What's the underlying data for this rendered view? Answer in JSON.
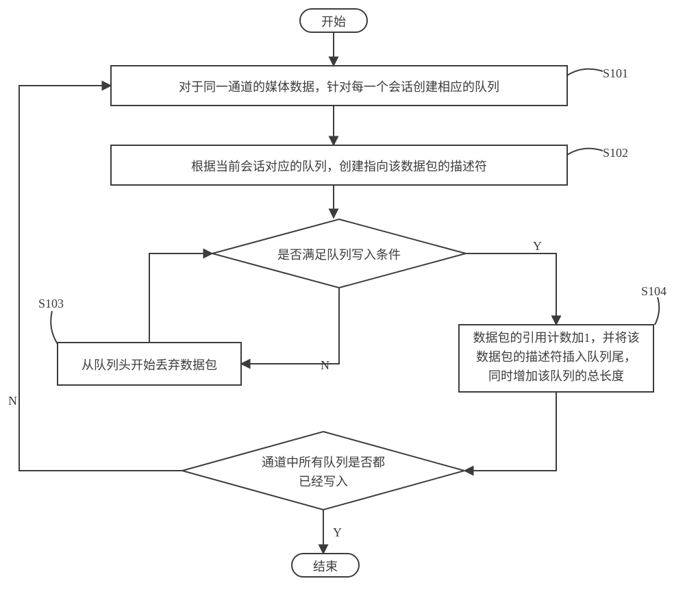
{
  "start": "开始",
  "end": "结束",
  "steps": {
    "s101": {
      "text": "对于同一通道的媒体数据，针对每一个会话创建相应的队列",
      "tag": "S101"
    },
    "s102": {
      "text": "根据当前会话对应的队列，创建指向该数据包的描述符",
      "tag": "S102"
    },
    "s103": {
      "text": "从队列头开始丢弃数据包",
      "tag": "S103"
    },
    "s104": {
      "line1": "数据包的引用计数加1，并将该",
      "line2": "数据包的描述符插入队列尾，",
      "line3": "同时增加该队列的总长度",
      "tag": "S104"
    }
  },
  "decisions": {
    "d1": "是否满足队列写入条件",
    "d2a": "通道中所有队列是否都",
    "d2b": "已经写入"
  },
  "edges": {
    "yes": "Y",
    "no": "N"
  }
}
